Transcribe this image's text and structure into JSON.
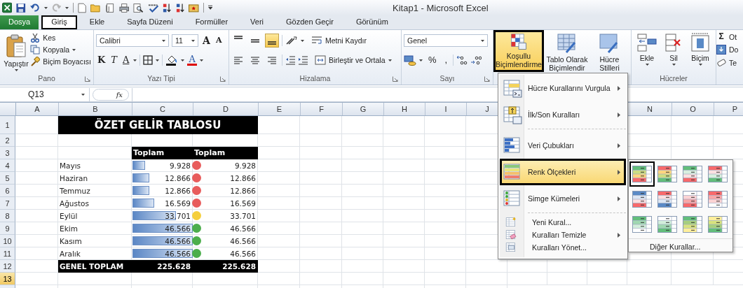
{
  "window": {
    "title": "Kitap1 - Microsoft Excel"
  },
  "tabs": [
    {
      "label": "Dosya",
      "kind": "file",
      "selected": false
    },
    {
      "label": "Giriş",
      "kind": "tab",
      "selected": true
    },
    {
      "label": "Ekle",
      "kind": "tab",
      "selected": false
    },
    {
      "label": "Sayfa Düzeni",
      "kind": "tab",
      "selected": false
    },
    {
      "label": "Formüller",
      "kind": "tab",
      "selected": false
    },
    {
      "label": "Veri",
      "kind": "tab",
      "selected": false
    },
    {
      "label": "Gözden Geçir",
      "kind": "tab",
      "selected": false
    },
    {
      "label": "Görünüm",
      "kind": "tab",
      "selected": false
    }
  ],
  "ribbon": {
    "clipboard": {
      "label": "Pano",
      "paste": "Yapıştır",
      "items": [
        "Kes",
        "Kopyala",
        "Biçim Boyacısı"
      ]
    },
    "font": {
      "label": "Yazı Tipi",
      "family": "Calibri",
      "size": "11",
      "grow": "A",
      "shrink": "A",
      "bold": "K",
      "italic": "T",
      "underline": "A",
      "font_color": "A"
    },
    "alignment": {
      "label": "Hizalama",
      "vertical": [
        {
          "selected": false
        },
        {
          "selected": false
        },
        {
          "selected": true
        }
      ],
      "horizontal": [
        {
          "selected": false
        },
        {
          "selected": false
        },
        {
          "selected": false
        }
      ],
      "wrap": "Metni Kaydır",
      "merge": "Birleştir ve Ortala"
    },
    "number": {
      "label": "Sayı",
      "format": "Genel",
      "percent": "%",
      "comma": ","
    },
    "styles": {
      "conditional": "Koşullu Biçimlendirme",
      "conditional_open": true,
      "table": "Tablo Olarak Biçimlendir",
      "cell_styles": "Hücre Stilleri"
    },
    "cells": {
      "label": "Hücreler",
      "buttons": [
        "Ekle",
        "Sil",
        "Biçim"
      ]
    },
    "editing": {
      "sigma": "Σ",
      "items": [
        "Ot",
        "Do",
        "Te"
      ]
    }
  },
  "formula_bar": {
    "name_box": "Q13",
    "fx": "fx"
  },
  "sheet": {
    "columns_left": [
      "A",
      "B",
      "C",
      "D",
      "E",
      "F",
      "G",
      "H",
      "I",
      "J"
    ],
    "columns_right": [
      "N",
      "O",
      "P"
    ],
    "rows": [
      {
        "number": "1",
        "selected": false,
        "kind": "title",
        "text": "ÖZET GELİR TABLOSU"
      },
      {
        "number": "2",
        "selected": false,
        "kind": "empty"
      },
      {
        "number": "3",
        "selected": false,
        "kind": "header",
        "c": "Toplam",
        "d": "Toplam"
      },
      {
        "number": "4",
        "selected": false,
        "kind": "data",
        "name": "Mayıs",
        "bar_value": "9.928",
        "level": 0.21,
        "color": "#e85c5c",
        "value": "9.928"
      },
      {
        "number": "5",
        "selected": false,
        "kind": "data",
        "name": "Haziran",
        "bar_value": "12.866",
        "level": 0.28,
        "color": "#e85c5c",
        "value": "12.866"
      },
      {
        "number": "6",
        "selected": false,
        "kind": "data",
        "name": "Temmuz",
        "bar_value": "12.866",
        "level": 0.28,
        "color": "#e85c5c",
        "value": "12.866"
      },
      {
        "number": "7",
        "selected": false,
        "kind": "data",
        "name": "Ağustos",
        "bar_value": "16.569",
        "level": 0.36,
        "color": "#e85c5c",
        "value": "16.569"
      },
      {
        "number": "8",
        "selected": false,
        "kind": "data",
        "name": "Eylül",
        "bar_value": "33.701",
        "level": 0.72,
        "color": "#f5cf3c",
        "value": "33.701"
      },
      {
        "number": "9",
        "selected": false,
        "kind": "data",
        "name": "Ekim",
        "bar_value": "46.566",
        "level": 1,
        "color": "#4cae4c",
        "value": "46.566"
      },
      {
        "number": "10",
        "selected": false,
        "kind": "data",
        "name": "Kasım",
        "bar_value": "46.566",
        "level": 1,
        "color": "#4cae4c",
        "value": "46.566"
      },
      {
        "number": "11",
        "selected": false,
        "kind": "data",
        "name": "Aralık",
        "bar_value": "46.566",
        "level": 1,
        "color": "#4cae4c",
        "value": "46.566"
      },
      {
        "number": "12",
        "selected": false,
        "kind": "total",
        "name": "GENEL TOPLAM",
        "c": "225.628",
        "d": "225.628"
      },
      {
        "number": "13",
        "selected": true,
        "kind": "empty"
      }
    ]
  },
  "conditional_menu": {
    "items": [
      {
        "kind": "large",
        "label": "Hücre Kurallarını Vurgula",
        "submenu": true,
        "selected": false
      },
      {
        "kind": "large",
        "label": "İlk/Son Kuralları",
        "submenu": true,
        "selected": false
      },
      {
        "kind": "separator"
      },
      {
        "kind": "large",
        "label": "Veri Çubukları",
        "submenu": true,
        "selected": false
      },
      {
        "kind": "large",
        "label": "Renk Ölçekleri",
        "submenu": true,
        "selected": true
      },
      {
        "kind": "large",
        "label": "Simge Kümeleri",
        "submenu": true,
        "selected": false
      },
      {
        "kind": "separator"
      },
      {
        "kind": "small",
        "label": "Yeni Kural...",
        "submenu": false,
        "selected": false
      },
      {
        "kind": "small",
        "label": "Kuralları Temizle",
        "submenu": true,
        "selected": false
      },
      {
        "kind": "small",
        "label": "Kuralları Yönet...",
        "submenu": false,
        "selected": false
      }
    ]
  },
  "color_scales": {
    "scales": [
      {
        "selected": true
      },
      {
        "selected": false
      },
      {
        "selected": false
      },
      {
        "selected": false
      },
      {
        "selected": false
      },
      {
        "selected": false
      },
      {
        "selected": false
      },
      {
        "selected": false
      },
      {
        "selected": false
      },
      {
        "selected": false
      },
      {
        "selected": false
      },
      {
        "selected": false
      }
    ],
    "more": "Diğer Kurallar..."
  }
}
